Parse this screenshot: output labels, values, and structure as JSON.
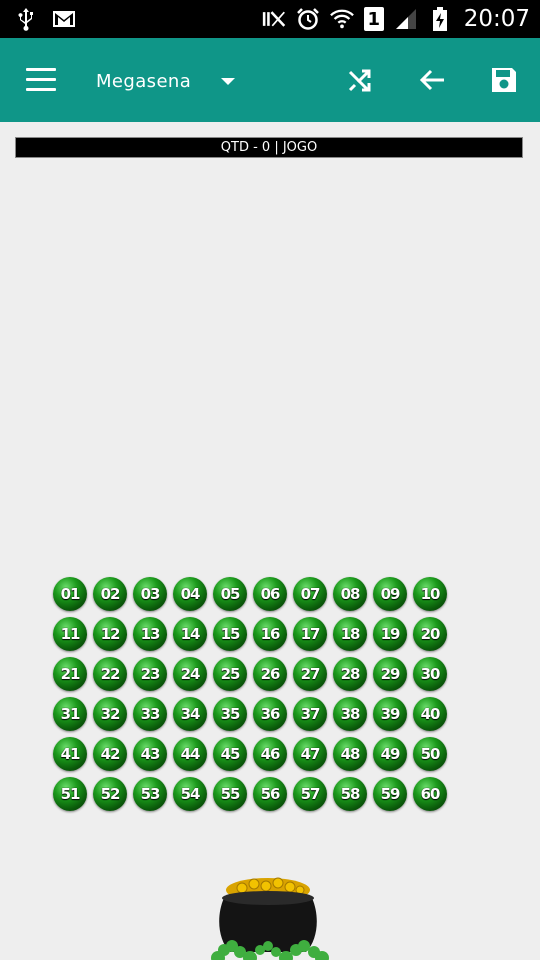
{
  "status_bar": {
    "time": "20:07",
    "sim_label": "1",
    "icons": [
      "usb-icon",
      "gmail-icon",
      "mute-icon",
      "alarm-icon",
      "wifi-icon",
      "sim-icon",
      "signal-icon",
      "battery-charging-icon"
    ]
  },
  "app_bar": {
    "title": "Megasena",
    "icons": [
      "menu-icon",
      "caret-down-icon",
      "shuffle-icon",
      "back-arrow-icon",
      "save-icon"
    ],
    "background_color": "#0f9688"
  },
  "game": {
    "count_label": "QTD - 0 | JOGO"
  },
  "numbers": [
    "01",
    "02",
    "03",
    "04",
    "05",
    "06",
    "07",
    "08",
    "09",
    "10",
    "11",
    "12",
    "13",
    "14",
    "15",
    "16",
    "17",
    "18",
    "19",
    "20",
    "21",
    "22",
    "23",
    "24",
    "25",
    "26",
    "27",
    "28",
    "29",
    "30",
    "31",
    "32",
    "33",
    "34",
    "35",
    "36",
    "37",
    "38",
    "39",
    "40",
    "41",
    "42",
    "43",
    "44",
    "45",
    "46",
    "47",
    "48",
    "49",
    "50",
    "51",
    "52",
    "53",
    "54",
    "55",
    "56",
    "57",
    "58",
    "59",
    "60"
  ],
  "colors": {
    "ball": "#1b9a1b",
    "header_strip": "#000000"
  }
}
